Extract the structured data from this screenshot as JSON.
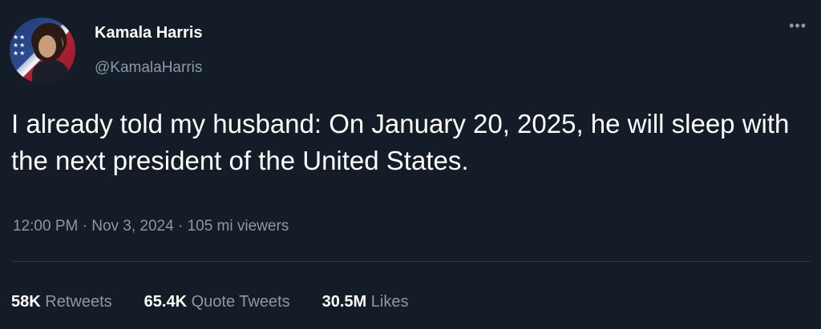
{
  "author": {
    "display_name": "Kamala Harris",
    "handle": "@KamalaHarris",
    "avatar_icon": "profile-photo"
  },
  "more_icon": "more-options-icon",
  "tweet": {
    "text": "I already told my husband: On January 20, 2025, he will sleep with the next president of the United States.",
    "time": "12:00 PM",
    "date": "Nov 3, 2024",
    "viewers": "105 mi viewers",
    "separator": " · "
  },
  "stats": {
    "retweets_count": "58K",
    "retweets_label": "Retweets",
    "quote_count": "65.4K",
    "quote_label": "Quote Tweets",
    "likes_count": "30.5M",
    "likes_label": "Likes"
  },
  "colors": {
    "background": "#141d27",
    "primary_text": "#ffffff",
    "secondary_text": "#8b98a5",
    "divider": "#2f3b47"
  }
}
